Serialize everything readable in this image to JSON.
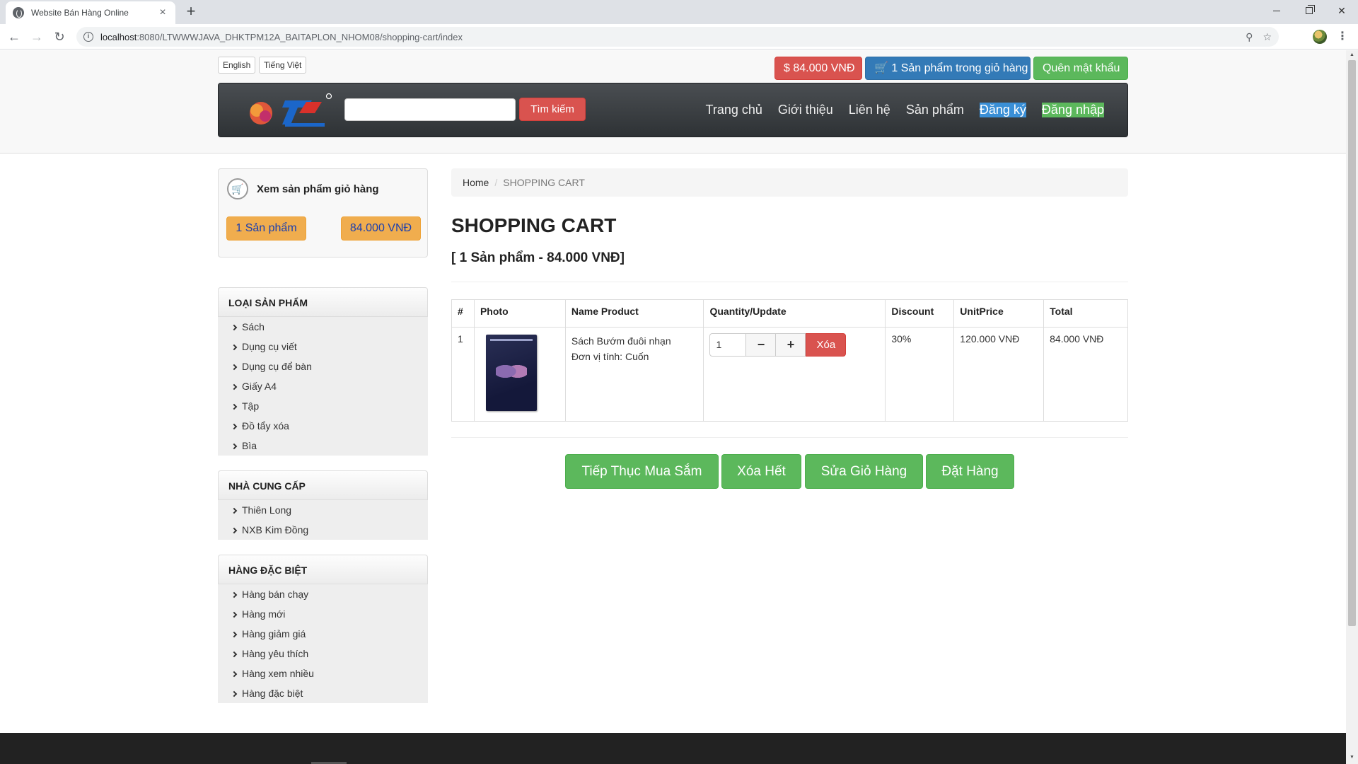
{
  "browser": {
    "tab_title": "Website Bán Hàng Online",
    "new_tab": "+",
    "url_host": "localhost",
    "url_rest": ":8080/LTWWWJAVA_DHKTPM12A_BAITAPLON_NHOM08/shopping-cart/index"
  },
  "language": {
    "english": "English",
    "vietnamese": "Tiếng Việt"
  },
  "topbar": {
    "price": "$ 84.000 VNĐ",
    "cart": "1 Sản phẩm trong giỏ hàng",
    "forgot": "Quên mật khẩu"
  },
  "nav": {
    "search_button": "Tìm kiếm",
    "search_value": "",
    "links": [
      "Trang chủ",
      "Giới thiệu",
      "Liên hệ",
      "Sản phẩm"
    ],
    "register": "Đăng ký",
    "login": "Đăng nhập"
  },
  "cart_panel": {
    "title": "Xem sản phẩm giỏ hàng",
    "count": "1 Sản phẩm",
    "total": "84.000 VNĐ"
  },
  "sidebar": {
    "categories": {
      "title": "LOẠI SẢN PHẨM",
      "items": [
        "Sách",
        "Dụng cụ viết",
        "Dụng cụ để bàn",
        "Giấy A4",
        "Tập",
        "Đồ tẩy xóa",
        "Bìa"
      ]
    },
    "suppliers": {
      "title": "NHÀ CUNG CẤP",
      "items": [
        "Thiên Long",
        "NXB Kim Đồng"
      ]
    },
    "special": {
      "title": "HÀNG ĐẶC BIỆT",
      "items": [
        "Hàng bán chạy",
        "Hàng mới",
        "Hàng giảm giá",
        "Hàng yêu thích",
        "Hàng xem nhiều",
        "Hàng đặc biệt"
      ]
    }
  },
  "breadcrumb": {
    "home": "Home",
    "separator": "/",
    "current": "SHOPPING CART"
  },
  "page": {
    "title": "SHOPPING CART",
    "subtitle": "[ 1 Sản phẩm - 84.000 VNĐ]"
  },
  "table": {
    "headers": [
      "#",
      "Photo",
      "Name Product",
      "Quantity/Update",
      "Discount",
      "UnitPrice",
      "Total"
    ],
    "rows": [
      {
        "index": "1",
        "name": "Sách Bướm đuôi nhạn",
        "unit": "Đơn vị tính: Cuốn",
        "quantity": "1",
        "minus": "−",
        "plus": "+",
        "delete": "Xóa",
        "discount": "30%",
        "unit_price": "120.000 VNĐ",
        "total": "84.000 VNĐ"
      }
    ]
  },
  "actions": {
    "continue": "Tiếp Thục Mua Sắm",
    "clear": "Xóa Hết",
    "edit": "Sửa Giỏ Hàng",
    "order": "Đặt Hàng"
  },
  "colors": {
    "danger": "#d9534f",
    "primary": "#337ab7",
    "success": "#5cb85c",
    "warning": "#f0ad4e",
    "navbar": "#2e3235"
  }
}
